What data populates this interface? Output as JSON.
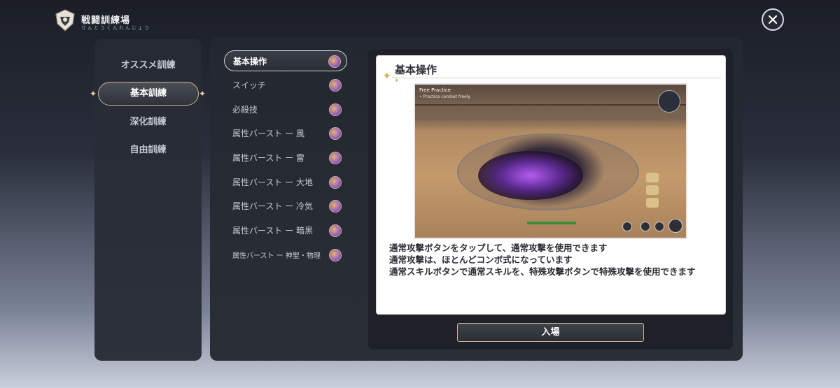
{
  "header": {
    "title": "戦闘訓練場",
    "subtitle": "せんとうくんれんじょう",
    "logo_icon": "shield-emblem-icon",
    "close_icon": "close-icon"
  },
  "categories": [
    {
      "label": "オススメ訓練",
      "active": false
    },
    {
      "label": "基本訓練",
      "active": true
    },
    {
      "label": "深化訓練",
      "active": false
    },
    {
      "label": "自由訓練",
      "active": false
    }
  ],
  "lessons": [
    {
      "label": "基本操作",
      "active": true
    },
    {
      "label": "スイッチ",
      "active": false
    },
    {
      "label": "必殺技",
      "active": false
    },
    {
      "label": "属性バースト ー 風",
      "active": false
    },
    {
      "label": "属性バースト ー 雷",
      "active": false
    },
    {
      "label": "属性バースト ー 大地",
      "active": false
    },
    {
      "label": "属性バースト ー 冷気",
      "active": false
    },
    {
      "label": "属性バースト ー 暗黒",
      "active": false
    },
    {
      "label": "属性バースト ー 神聖・物理",
      "active": false
    }
  ],
  "detail": {
    "title": "基本操作",
    "preview": {
      "hud_title": "Free Practice",
      "hud_sub": "• Practice combat freely"
    },
    "description": [
      "通常攻撃ボタンをタップして、通常攻撃を使用できます",
      "通常攻撃は、ほとんどコンボ式になっています",
      "通常スキルボタンで通常スキルを、特殊攻撃ボタンで特殊攻撃を使用できます"
    ]
  },
  "enter_button": "入場",
  "colors": {
    "accent_gold": "#c9b48a",
    "panel_dark": "#262a34",
    "card_bg": "#ffffff"
  }
}
